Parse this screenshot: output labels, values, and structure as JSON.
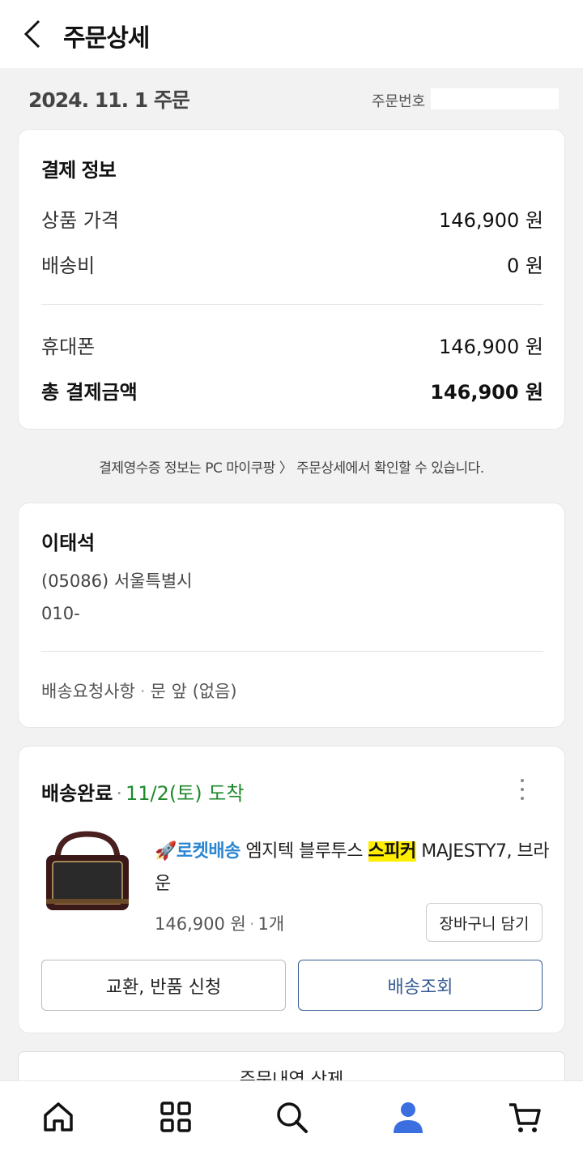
{
  "header": {
    "title": "주문상세"
  },
  "order": {
    "date": "2024. 11. 1 주문",
    "number_label": "주문번호"
  },
  "payment": {
    "title": "결제 정보",
    "rows": [
      {
        "label": "상품 가격",
        "value": "146,900 원"
      },
      {
        "label": "배송비",
        "value": "0 원"
      }
    ],
    "method": {
      "label": "휴대폰",
      "value": "146,900 원"
    },
    "total": {
      "label": "총 결제금액",
      "value": "146,900 원"
    }
  },
  "receipt_notice": "결제영수증 정보는 PC 마이쿠팡 〉 주문상세에서 확인할 수 있습니다.",
  "address": {
    "name": "이태석",
    "line1": "(05086) 서울특별시",
    "phone": "010-",
    "request_label": "배송요청사항",
    "request_value": "문 앞 (없음)"
  },
  "shipment": {
    "status": "배송완료",
    "arrival": "11/2(토) 도착",
    "product": {
      "badge": "로켓배송",
      "name_before": " 엠지텍 블루투스 ",
      "name_highlight": "스피커",
      "name_after": " MAJESTY7, 브라운",
      "price": "146,900 원",
      "quantity": "1개"
    },
    "cart_button": "장바구니 담기",
    "return_button": "교환, 반품 신청",
    "track_button": "배송조회"
  },
  "delete_button": "주문내역 삭제",
  "nav": {
    "items": [
      {
        "icon": "home-icon"
      },
      {
        "icon": "category-grid-icon"
      },
      {
        "icon": "search-icon"
      },
      {
        "icon": "my-page-icon",
        "active": true
      },
      {
        "icon": "cart-icon"
      }
    ]
  },
  "colors": {
    "arrival_green": "#1e8a2c",
    "rocket_blue": "#2b86d3",
    "highlight": "#ffee00",
    "track_blue": "#345a92",
    "nav_active": "#3b6fe0"
  }
}
